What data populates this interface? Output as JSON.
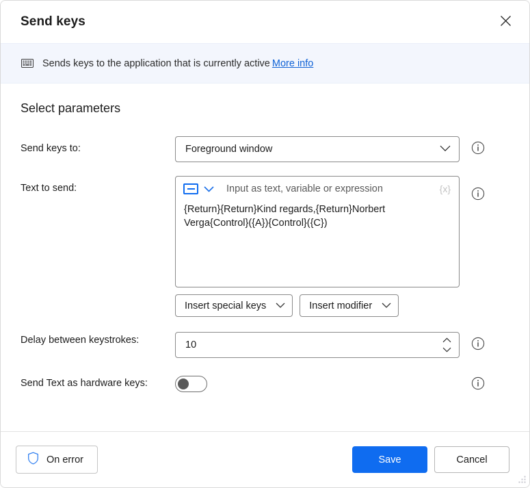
{
  "dialog": {
    "title": "Send keys",
    "close_label": "×"
  },
  "banner": {
    "icon": "keyboard-icon",
    "text": "Sends keys to the application that is currently active",
    "link": "More info"
  },
  "section": {
    "heading": "Select parameters"
  },
  "fields": {
    "send_keys_to": {
      "label": "Send keys to:",
      "value": "Foreground window",
      "info": "info-icon"
    },
    "text_to_send": {
      "label": "Text to send:",
      "toolbar_placeholder": "Input as text, variable or expression",
      "expression_badge": "{x}",
      "value": "{Return}{Return}Kind regards,{Return}Norbert Verga{Control}({A}){Control}({C})",
      "insert_special_keys": "Insert special keys",
      "insert_modifier": "Insert modifier",
      "info": "info-icon"
    },
    "delay": {
      "label": "Delay between keystrokes:",
      "value": "10",
      "info": "info-icon"
    },
    "hardware_keys": {
      "label": "Send Text as hardware keys:",
      "state": "off",
      "info": "info-icon"
    }
  },
  "footer": {
    "on_error": "On error",
    "save": "Save",
    "cancel": "Cancel"
  },
  "colors": {
    "accent": "#0f6cf0",
    "banner_bg": "#f3f6fd",
    "link": "#0f62d6",
    "border": "#8a8a8a"
  }
}
